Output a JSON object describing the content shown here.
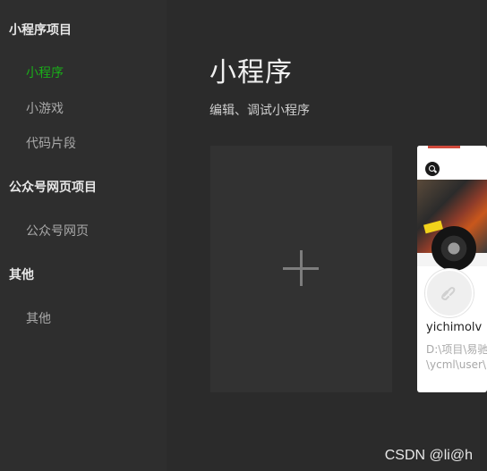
{
  "sidebar": {
    "sections": [
      {
        "title": "小程序项目",
        "items": [
          {
            "label": "小程序",
            "active": true
          },
          {
            "label": "小游戏",
            "active": false
          },
          {
            "label": "代码片段",
            "active": false
          }
        ]
      },
      {
        "title": "公众号网页项目",
        "items": [
          {
            "label": "公众号网页",
            "active": false
          }
        ]
      },
      {
        "title": "其他",
        "items": [
          {
            "label": "其他",
            "active": false
          }
        ]
      }
    ]
  },
  "main": {
    "title": "小程序",
    "subtitle": "编辑、调试小程序",
    "new_card": {
      "icon": "plus-icon"
    },
    "projects": [
      {
        "name": "yichimolv",
        "path_line1": "D:\\项目\\易驰",
        "path_line2": "\\ycml\\user\\u",
        "avatar_icon": "link-icon"
      }
    ]
  },
  "watermark": "CSDN @li@h",
  "colors": {
    "accent": "#1aad19",
    "sidebar_bg": "#2e2e2e",
    "main_bg": "#2b2b2b",
    "card_bg": "#323232"
  }
}
